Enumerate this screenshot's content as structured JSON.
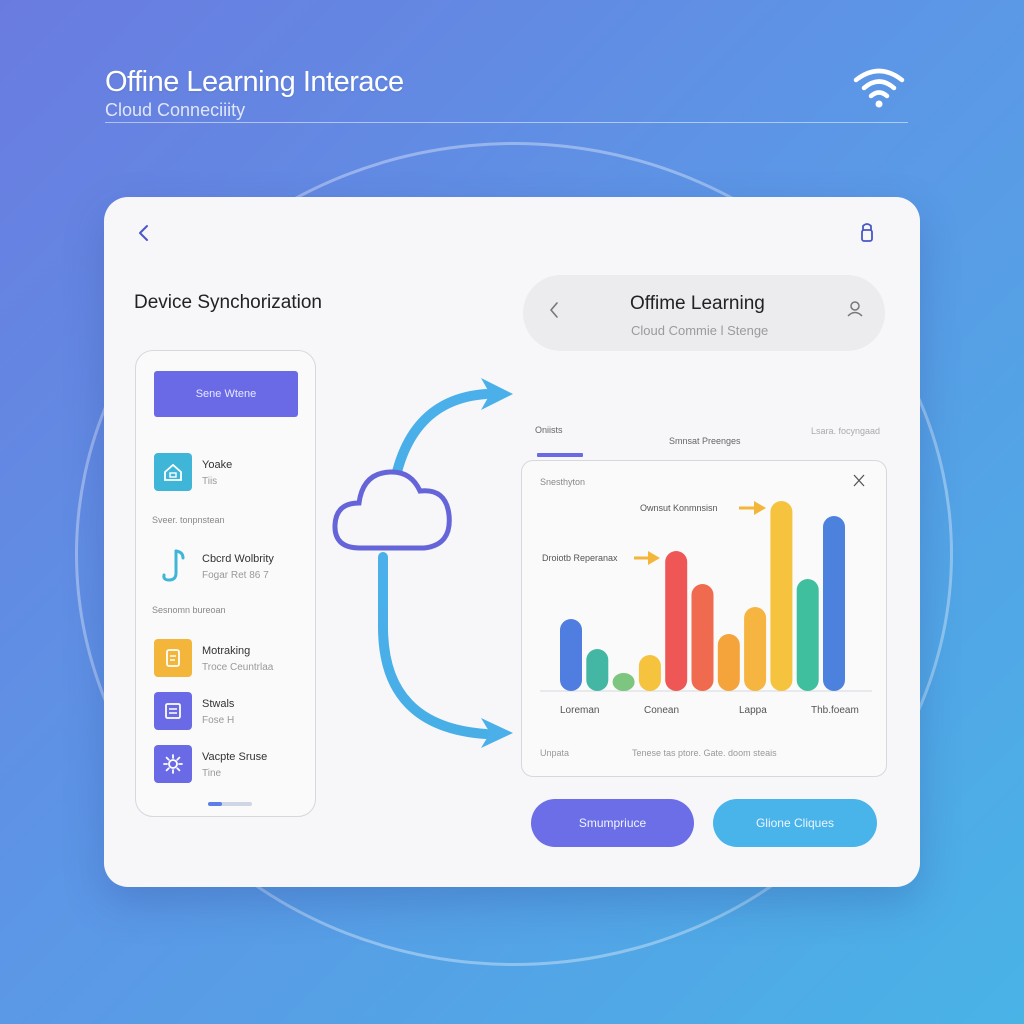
{
  "header": {
    "title": "Offine Learning Interace",
    "subtitle": "Cloud Conneciiity",
    "wifi_icon": "wifi-icon"
  },
  "card": {
    "back_icon": "chevron-left-icon",
    "lock_icon": "lock-icon",
    "section_title": "Device Synchorization"
  },
  "phone": {
    "button_label": "Sene Wtene",
    "items": [
      {
        "title": "Yoake",
        "sub": "Tiis",
        "icon": "home-icon",
        "color": "#3fb6d8"
      },
      {
        "title": "Cbcrd Wolbrity",
        "sub": "Fogar Ret 86 7",
        "icon": "music-note-icon",
        "color": "#3fb6d8"
      },
      {
        "title": "Motraking",
        "sub": "Troce Ceuntrlaa",
        "icon": "document-icon",
        "color": "#f4b63a"
      },
      {
        "title": "Stwals",
        "sub": "Fose H",
        "icon": "list-icon",
        "color": "#6a6ae6"
      },
      {
        "title": "Vacpte Sruse",
        "sub": "Tine",
        "icon": "settings-icon",
        "color": "#6a6ae6"
      }
    ],
    "section_labels": [
      "Sveer. tonpnstean",
      "Sesnomn bureoan"
    ]
  },
  "right_panel": {
    "title": "Offime Learning",
    "subtitle": "Cloud Commie l Stenge",
    "back_icon": "chevron-left-icon",
    "person_icon": "person-icon",
    "tab_left": "Oniists",
    "tab_center": "Smnsat Preenges",
    "tab_right": "Lsara. focyngaad"
  },
  "chart_data": {
    "type": "bar",
    "title": "Snesthyton",
    "close_icon": "close-icon",
    "values": [
      72,
      42,
      18,
      36,
      140,
      107,
      57,
      84,
      190,
      112,
      175
    ],
    "colors": [
      "#4f7ee0",
      "#43b7a4",
      "#7cc67f",
      "#f6c33f",
      "#ee5756",
      "#ef6a4e",
      "#f4a43a",
      "#f6b540",
      "#f6c33f",
      "#3fbf9e",
      "#4c82de"
    ],
    "x_labels": [
      "Loreman",
      "Conean",
      "Lappa",
      "Thb.foeam"
    ],
    "annotations": [
      {
        "text": "Ownsut Konmnsisn"
      },
      {
        "text": "Droiotb Reperanax"
      }
    ],
    "footer_left": "Unpata",
    "footer_right": "Tenese tas ptore. Gate. doom steais"
  },
  "buttons": {
    "primary": "Smumpriuce",
    "secondary": "Glione Cliques"
  },
  "colors": {
    "accent": "#6a6ae6",
    "secondary_accent": "#48b4ea",
    "arrow": "#f4b63a"
  }
}
